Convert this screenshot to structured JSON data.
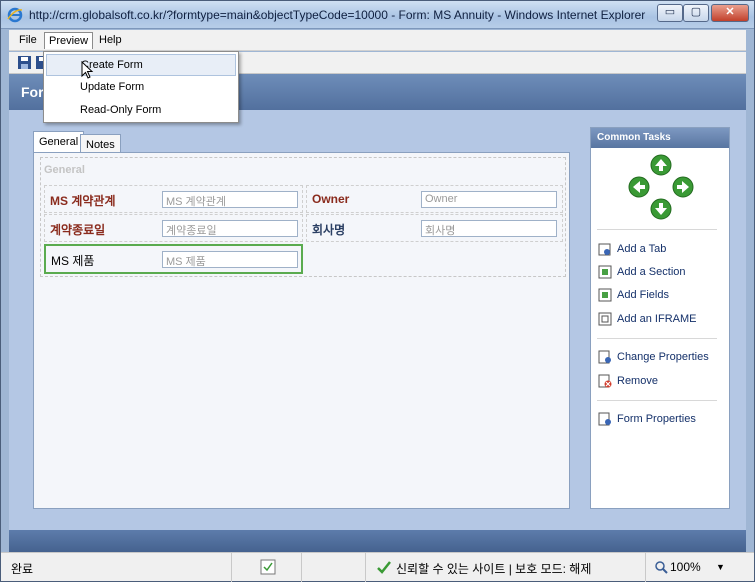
{
  "window": {
    "title": "http://crm.globalsoft.co.kr/?formtype=main&objectTypeCode=10000 - Form: MS Annuity - Windows Internet Explorer",
    "min_label": "▭",
    "max_label": "▢",
    "close_label": "✕"
  },
  "menu": {
    "file": "File",
    "preview": "Preview",
    "help": "Help"
  },
  "preview_menu": {
    "items": [
      "Create Form",
      "Update Form",
      "Read-Only Form"
    ]
  },
  "header": {
    "text": "For"
  },
  "tabs": [
    "General",
    "Notes"
  ],
  "section": {
    "label": "General",
    "fields": [
      {
        "label": "MS 계약관계",
        "placeholder": "MS 계약관계"
      },
      {
        "label": "Owner",
        "placeholder": "Owner"
      },
      {
        "label": "계약종료일",
        "placeholder": "계약종료일"
      },
      {
        "label": "회사명",
        "placeholder": "회사명"
      },
      {
        "label": "MS 제품",
        "placeholder": "MS 제품"
      }
    ]
  },
  "tasks": {
    "title": "Common Tasks",
    "items": [
      "Add a Tab",
      "Add a Section",
      "Add Fields",
      "Add an IFRAME",
      "Change Properties",
      "Remove",
      "Form Properties"
    ]
  },
  "status": {
    "left": "완료",
    "trusted": "신뢰할 수 있는 사이트 | 보호 모드: 해제",
    "zoom": "100%"
  },
  "colors": {
    "accent_blue": "#52709e",
    "selected_green": "#5aab4f",
    "required_red": "#8a2b1d"
  }
}
